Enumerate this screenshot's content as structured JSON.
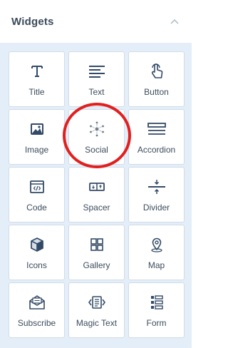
{
  "panel": {
    "title": "Widgets",
    "collapse_icon": "chevron-up-icon"
  },
  "widgets": [
    {
      "label": "Title",
      "icon": "title-icon"
    },
    {
      "label": "Text",
      "icon": "text-icon"
    },
    {
      "label": "Button",
      "icon": "button-icon"
    },
    {
      "label": "Image",
      "icon": "image-icon"
    },
    {
      "label": "Social",
      "icon": "social-icon"
    },
    {
      "label": "Accordion",
      "icon": "accordion-icon"
    },
    {
      "label": "Code",
      "icon": "code-icon"
    },
    {
      "label": "Spacer",
      "icon": "spacer-icon"
    },
    {
      "label": "Divider",
      "icon": "divider-icon"
    },
    {
      "label": "Icons",
      "icon": "cube-icon"
    },
    {
      "label": "Gallery",
      "icon": "gallery-icon"
    },
    {
      "label": "Map",
      "icon": "map-pin-icon"
    },
    {
      "label": "Subscribe",
      "icon": "envelope-icon"
    },
    {
      "label": "Magic Text",
      "icon": "magic-text-icon"
    },
    {
      "label": "Form",
      "icon": "form-icon"
    }
  ],
  "colors": {
    "accent": "#334a66",
    "highlight": "#e21f1f",
    "grid_background": "#e4eef8"
  }
}
